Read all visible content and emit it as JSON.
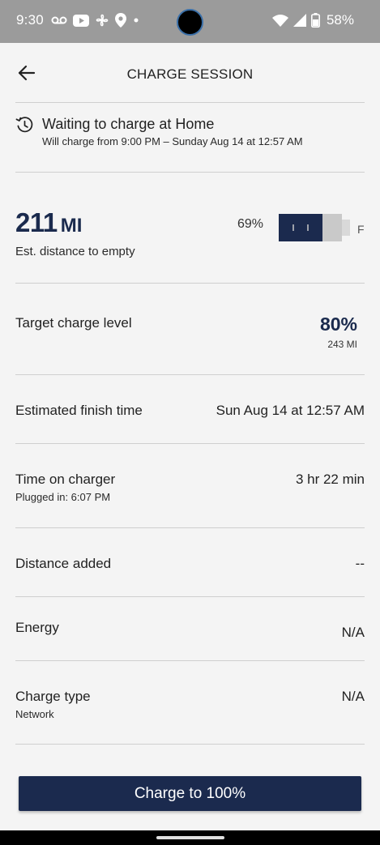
{
  "status_bar": {
    "time": "9:30",
    "battery": "58%",
    "icons": [
      "voicemail-icon",
      "youtube-icon",
      "fan-icon",
      "location-icon",
      "dot-icon",
      "wifi-icon",
      "signal-icon",
      "battery-icon"
    ]
  },
  "header": {
    "title": "CHARGE SESSION",
    "back_icon": "arrow-left-icon"
  },
  "waiting": {
    "title": "Waiting to charge at Home",
    "subtitle": "Will charge from 9:00 PM – Sunday Aug 14 at 12:57 AM",
    "icon": "history-icon"
  },
  "range": {
    "value": "211",
    "unit": "MI",
    "label": "Est. distance to empty",
    "battery_percent": "69%",
    "battery_level": 0.69,
    "full_label": "F"
  },
  "target": {
    "label": "Target charge level",
    "percent": "80%",
    "miles": "243 MI"
  },
  "finish": {
    "label": "Estimated finish time",
    "value": "Sun Aug 14 at 12:57 AM"
  },
  "time_on_charger": {
    "label": "Time on charger",
    "sublabel": "Plugged in: 6:07 PM",
    "value": "3 hr 22 min"
  },
  "distance_added": {
    "label": "Distance added",
    "value": "--"
  },
  "energy": {
    "label": "Energy",
    "value": "N/A"
  },
  "charge_type": {
    "label": "Charge type",
    "sublabel": "Network",
    "value": "N/A"
  },
  "cta": {
    "label": "Charge to 100%"
  },
  "colors": {
    "accent": "#1b2a4e",
    "status_bar": "#9b9b9b",
    "background": "#f4f4f4"
  }
}
